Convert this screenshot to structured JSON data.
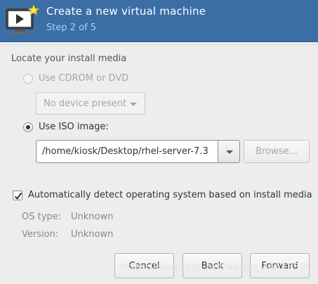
{
  "header": {
    "title": "Create a new virtual machine",
    "step": "Step 2 of 5",
    "icon": "virtual-machine-monitor-icon",
    "accent_color": "#3b6ea5"
  },
  "install_media": {
    "section_label": "Locate your install media",
    "cdrom_option": {
      "label": "Use CDROM or DVD",
      "selected": false,
      "enabled": false,
      "device_combo": "No device present"
    },
    "iso_option": {
      "label": "Use ISO image:",
      "selected": true,
      "path_value": "/home/kiosk/Desktop/rhel-server-7.3",
      "browse_label": "Browse..."
    }
  },
  "os_detection": {
    "checkbox_label": "Automatically detect operating system based on install media",
    "checked": true,
    "os_type_label": "OS type:",
    "os_type_value": "Unknown",
    "version_label": "Version:",
    "version_value": "Unknown"
  },
  "footer": {
    "cancel_label": "Cancel",
    "back_label": "Back",
    "forward_label": "Forward"
  },
  "watermark": "https://blog.csdn.net/weixin_44416500"
}
